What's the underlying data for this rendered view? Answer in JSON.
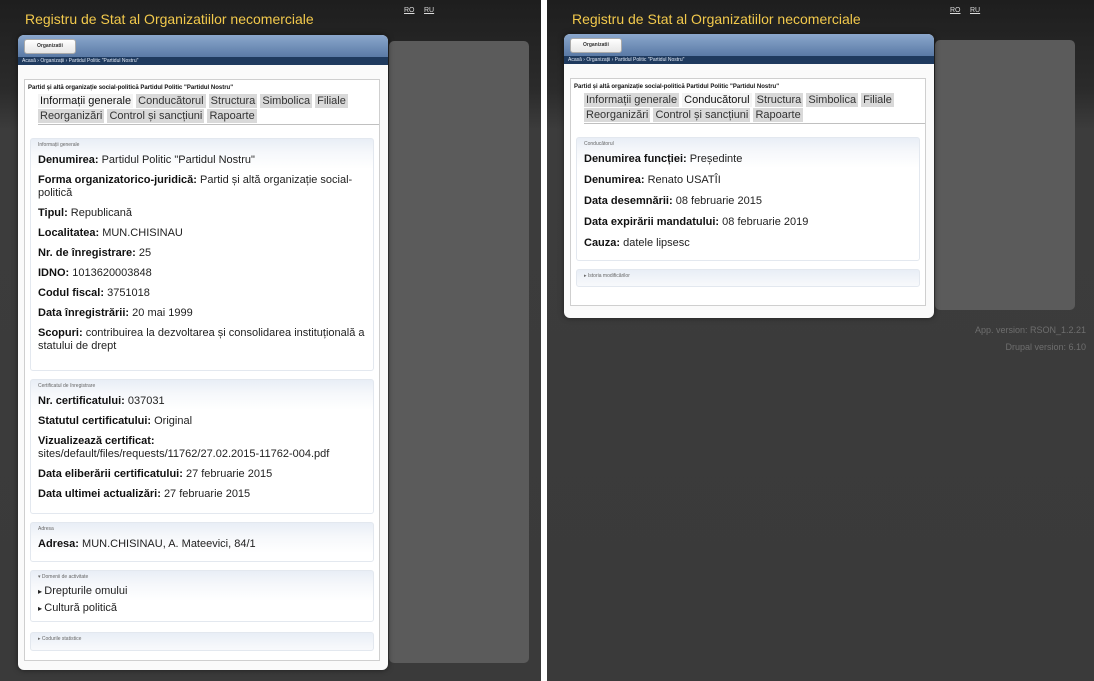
{
  "site_title": "Registru de Stat al Organizatiilor necomerciale",
  "lang": {
    "ro": "RO",
    "ru": "RU"
  },
  "versions": {
    "app": "App. version: RSON_1.2.21",
    "drupal": "Drupal version: 6.10"
  },
  "window": {
    "button_label": "Organizatii",
    "breadcrumb": "Acasă › Organizații › Partidul Politic \"Partidul Nostru\"",
    "page_heading": "Partid și altă organizație social-politică Partidul Politic \"Partidul Nostru\""
  },
  "tabs": [
    "Informații generale",
    "Conducătorul",
    "Structura",
    "Simbolica",
    "Filiale",
    "Reorganizări",
    "Control și sancțiuni",
    "Rapoarte"
  ],
  "left": {
    "info": {
      "legend": "Informații generale",
      "rows": [
        {
          "label": "Denumirea:",
          "value": "Partidul Politic \"Partidul Nostru\""
        },
        {
          "label": "Forma organizatorico-juridică:",
          "value": "Partid și altă organizație social-politică"
        },
        {
          "label": "Tipul:",
          "value": "Republicană"
        },
        {
          "label": "Localitatea:",
          "value": "MUN.CHISINAU"
        },
        {
          "label": "Nr. de înregistrare:",
          "value": "25"
        },
        {
          "label": "IDNO:",
          "value": "1013620003848"
        },
        {
          "label": "Codul fiscal:",
          "value": "3751018"
        },
        {
          "label": "Data înregistrării:",
          "value": "20 mai 1999"
        },
        {
          "label": "Scopuri:",
          "value": "contribuirea la dezvoltarea și consolidarea instituțională a statului de drept"
        }
      ]
    },
    "cert": {
      "legend": "Certificatul de înregistrare",
      "rows": [
        {
          "label": "Nr. certificatului:",
          "value": "037031"
        },
        {
          "label": "Statutul certificatului:",
          "value": "Original"
        },
        {
          "label": "Vizualizează certificat:",
          "value": "sites/default/files/requests/11762/27.02.2015-11762-004.pdf"
        },
        {
          "label": "Data eliberării certificatului:",
          "value": "27 februarie 2015"
        },
        {
          "label": "Data ultimei actualizări:",
          "value": "27 februarie 2015"
        }
      ]
    },
    "address": {
      "legend": "Adresa",
      "rows": [
        {
          "label": "Adresa:",
          "value": "MUN.CHISINAU, A. Mateevici, 84/1"
        }
      ]
    },
    "domains": {
      "legend": "▾ Domenii de activitate",
      "items": [
        "Drepturile omului",
        "Cultură politică"
      ]
    },
    "stat_codes": {
      "legend": "▸ Codurile statistice"
    }
  },
  "right": {
    "leader": {
      "legend": "Conducătorul",
      "rows": [
        {
          "label": "Denumirea funcției:",
          "value": "Președinte"
        },
        {
          "label": "Denumirea:",
          "value": "Renato USATÎI"
        },
        {
          "label": "Data desemnării:",
          "value": "08 februarie 2015"
        },
        {
          "label": "Data expirării mandatului:",
          "value": "08 februarie 2019"
        },
        {
          "label": "Cauza:",
          "value": "datele lipsesc"
        }
      ]
    },
    "history": {
      "legend": "▸ Istoria modificărilor"
    }
  }
}
